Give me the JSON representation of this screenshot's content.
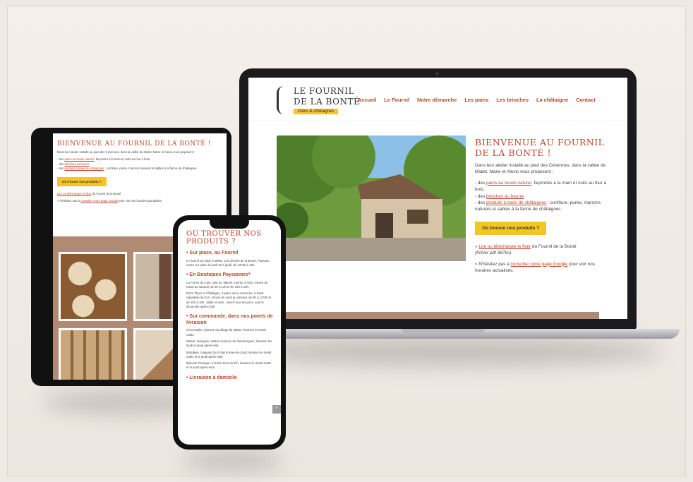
{
  "laptop": {
    "logo": {
      "line1": "LE FOURNIL",
      "line2": "DE LA BONTÉ",
      "tagline": "Pains & châtaignes"
    },
    "nav": [
      "Accueil",
      "Le Fournil",
      "Notre démarche",
      "Les pains",
      "Les brioches",
      "La châtaigne",
      "Contact"
    ],
    "welcome_title": "BIENVENUE AU FOURNIL DE LA BONTÉ !",
    "intro": "Dans leur atelier installé au pied des Cévennes, dans la vallée de Mialet, Marie et Alexis vous proposent :",
    "item1_pre": "- des ",
    "item1_link": "pains au levain naturel",
    "item1_post": ", façonnés à la main et cuits au four à bois,",
    "item2_pre": "- des ",
    "item2_link": "brioches au beurre",
    "item2_post": ",",
    "item3_pre": "- des ",
    "item3_link": "produits à base de châtaignes",
    "item3_post": " : confiture, purée, marrons naturels et sablés à la farine de châtaignes.",
    "cta_button": "Où trouver nos produits ?",
    "flyer_pre": "» ",
    "flyer_link": "Lire ou télécharger le flyer",
    "flyer_post": " du Fournil de la Bonté",
    "flyer_file": "(fichier pdf 387ko).",
    "google_pre": "» N'hésitez pas à ",
    "google_link": "consulter notre page Google",
    "google_post": " pour voir nos horaires actualisés."
  },
  "tablet": {
    "title": "BIENVENUE AU FOURNIL DE LA BONTÉ !",
    "cta_button": "Où trouver nos produits ?"
  },
  "phone": {
    "title": "OÙ TROUVER NOS PRODUITS ?",
    "s1_title": "• Sur place, au Fournil",
    "s1_text": "Le fournil est situé à Mialet, 130 chemin de la Bonté, Paussan. Vente sur place le lundi et le jeudi, de 17h30 à 19h.",
    "s2_title": "• En Boutiques Paysannes*",
    "s2_p1": "La Ferme du Coin, 1bis av. Marcel Cachin, à Alès. Ouvert du mardi au samedi, de 9h à 12h et de 15h à 19h.",
    "s2_p2": "Entre Thym et Châtaigne, 2 place de la couronne, à Saint-Hippolyte-du-Fort. Ouvert du lundi au samedi, de 9h à 12h30 et de 15h à 19h. Juillet et août : ouvert tous les jours, sauf le dimanche après-midi.",
    "s3_title": "• Sur commande, dans nos points de livraison",
    "s3_p1": "Chez Mialet, épicerie du village de Mialet, livraison le mardi matin.",
    "s3_p2": "Station Jeanjean, station essence de Générargues, livraison les lundi et jeudi après-midi.",
    "s3_p3": "Biotidées, magasin bio à Saint-Jean-du-Gard, livraison le mardi matin et le jeudi après-midi.",
    "s3_p4": "Épicerie Pinnique, à Saint-Jean-du-Pin, livraison le mardi matin et le jeudi après-midi.",
    "s4_title": "• Livraison à domicile",
    "scroll_icon": "^"
  }
}
